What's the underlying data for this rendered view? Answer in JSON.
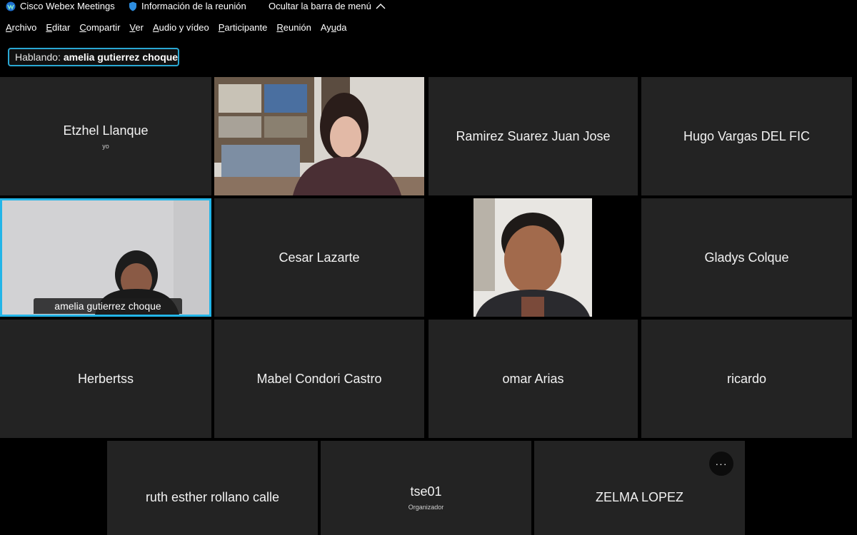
{
  "titlebar": {
    "app_name": "Cisco Webex Meetings",
    "meeting_info": "Información de la reunión",
    "hide_menu": "Ocultar la barra de menú"
  },
  "menu": [
    {
      "label": "Archivo",
      "mnemonic": "A",
      "rest": "rchivo"
    },
    {
      "label": "Editar",
      "mnemonic": "E",
      "rest": "ditar"
    },
    {
      "label": "Compartir",
      "mnemonic": "C",
      "rest": "ompartir"
    },
    {
      "label": "Ver",
      "mnemonic": "V",
      "rest": "er"
    },
    {
      "label": "Audio y vídeo",
      "mnemonic": "A",
      "rest": "udio y vídeo"
    },
    {
      "label": "Participante",
      "mnemonic": "P",
      "rest": "articipante"
    },
    {
      "label": "Reunión",
      "mnemonic": "R",
      "rest": "eunión"
    },
    {
      "label": "Ayuda",
      "pre": "Ay",
      "mnemonic": "u",
      "rest": "da"
    }
  ],
  "speaking": {
    "label": "Hablando:",
    "name": "amelia gutierrez choque"
  },
  "participants": [
    {
      "name": "Etzhel Llanque",
      "sub": "yo"
    },
    {
      "name": "",
      "video": true
    },
    {
      "name": "Ramirez Suarez Juan Jose"
    },
    {
      "name": "Hugo Vargas DEL FIC"
    },
    {
      "name": "amelia gutierrez choque",
      "video": true,
      "active": true
    },
    {
      "name": "Cesar Lazarte"
    },
    {
      "name": "",
      "video": true
    },
    {
      "name": "Gladys Colque"
    },
    {
      "name": "Herbertss"
    },
    {
      "name": "Mabel Condori Castro"
    },
    {
      "name": "omar Arias"
    },
    {
      "name": "ricardo"
    },
    {
      "name": "ruth esther rollano calle"
    },
    {
      "name": "tse01",
      "sub": "Organizador"
    },
    {
      "name": "ZELMA LOPEZ"
    }
  ],
  "more_button": "···",
  "colors": {
    "accent": "#23b5e8",
    "tile": "#232323",
    "background": "#000000"
  }
}
